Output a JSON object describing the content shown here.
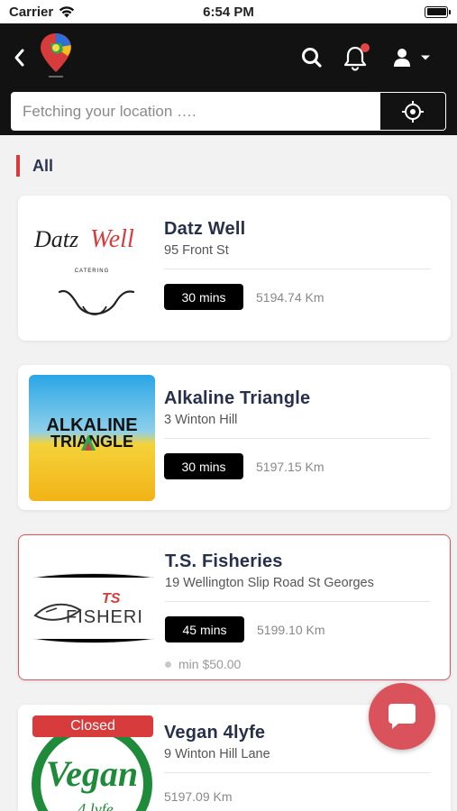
{
  "status_bar": {
    "carrier": "Carrier",
    "time": "6:54 PM"
  },
  "header": {
    "location_placeholder": "Fetching your location ….",
    "has_notification": true
  },
  "section": {
    "title": "All"
  },
  "restaurants": [
    {
      "name": "Datz Well",
      "address": "95 Front St",
      "time": "30 mins",
      "distance": "5194.74 Km",
      "logo_text": "Datz Well",
      "logo_sub": "CATERING"
    },
    {
      "name": "Alkaline Triangle",
      "address": "3 Winton Hill",
      "time": "30 mins",
      "distance": "5197.15 Km",
      "logo_text": "ALKALINE TRIANGLE"
    },
    {
      "name": "T.S. Fisheries",
      "address": "19 Wellington Slip Road St Georges",
      "time": "45 mins",
      "distance": "5199.10 Km",
      "min_order": "min $50.00",
      "logo_text": "FISHERI",
      "logo_top": "T.S"
    },
    {
      "name": "Vegan 4lyfe",
      "address": "9 Winton Hill Lane",
      "distance": "5197.09 Km",
      "status": "Closed",
      "logo_text": "Vegan",
      "logo_sub": "4 lyfe"
    }
  ],
  "colors": {
    "accent": "#d83b3b",
    "header_bg": "#121212",
    "title": "#27304a"
  }
}
